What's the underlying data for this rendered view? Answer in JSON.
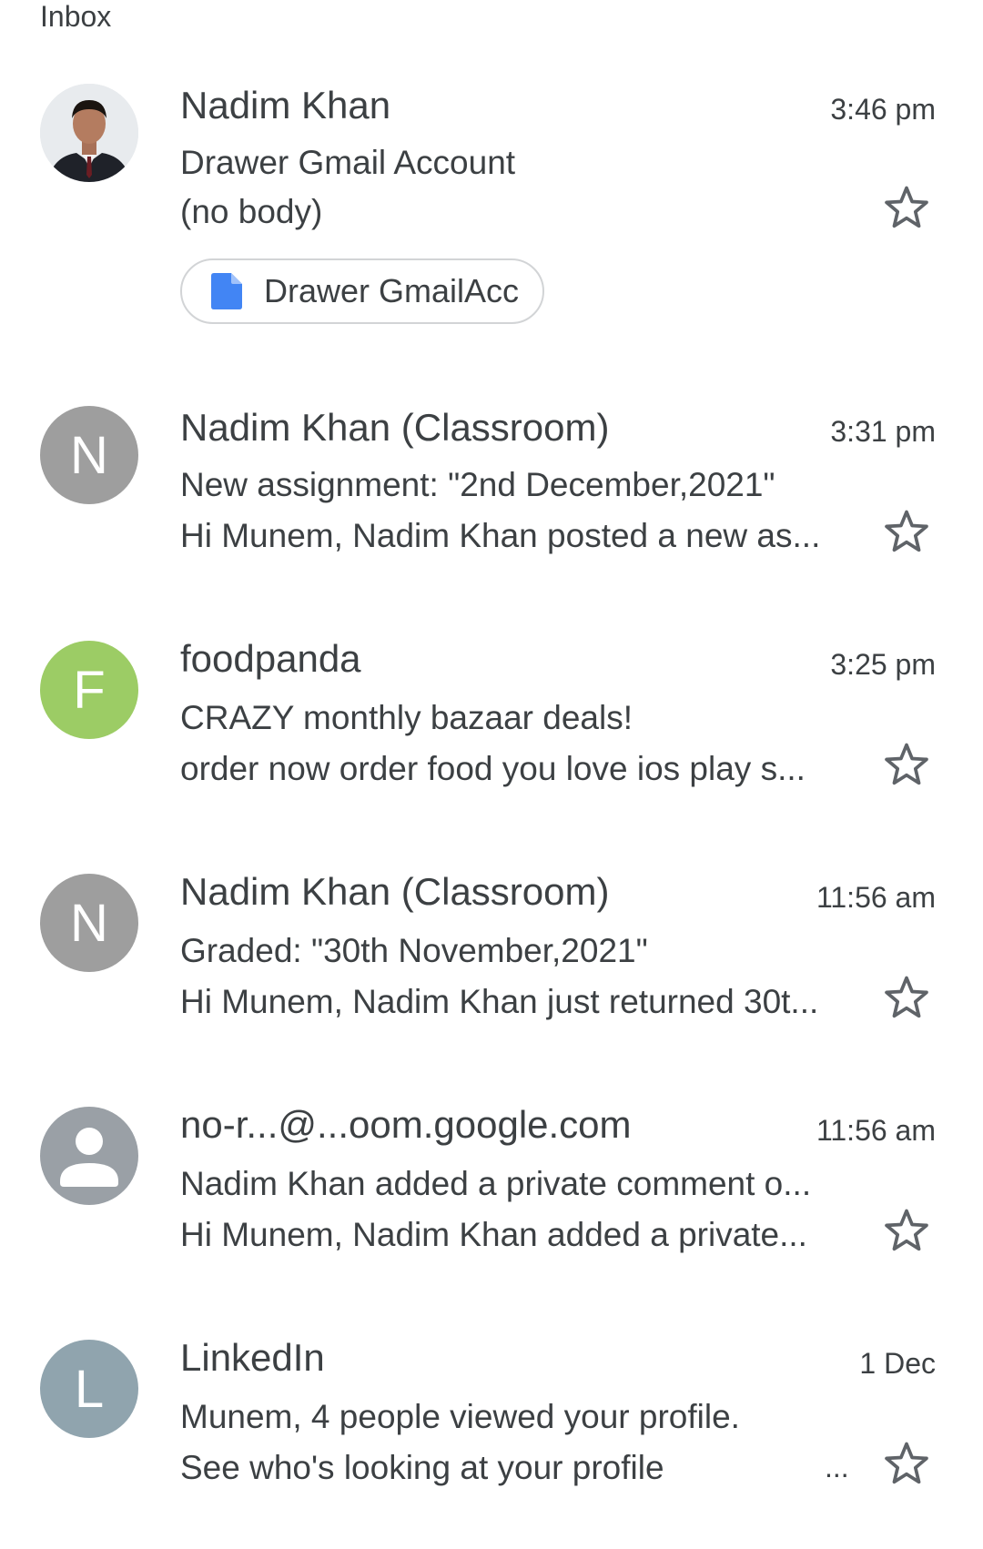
{
  "header": {
    "title": "Inbox"
  },
  "emails": [
    {
      "sender": "Nadim Khan",
      "time": "3:46 pm",
      "subject": "Drawer Gmail Account",
      "snippet": "(no body)",
      "avatar": {
        "type": "photo"
      },
      "attachment": {
        "label": "Drawer GmailAcc",
        "icon": "doc-icon",
        "color": "#4285f4"
      },
      "starred": false
    },
    {
      "sender": "Nadim Khan (Classroom)",
      "time": "3:31 pm",
      "subject": "New assignment: \"2nd December,2021\"",
      "snippet": "Hi Munem, Nadim Khan posted a new as...",
      "avatar": {
        "type": "letter",
        "letter": "N",
        "color": "#9e9e9e"
      },
      "starred": false
    },
    {
      "sender": "foodpanda",
      "time": "3:25 pm",
      "subject": "CRAZY monthly bazaar deals!",
      "snippet": "order now order food you love ios play s...",
      "avatar": {
        "type": "letter",
        "letter": "F",
        "color": "#9ccc65"
      },
      "starred": false
    },
    {
      "sender": "Nadim Khan (Classroom)",
      "time": "11:56 am",
      "subject": "Graded: \"30th  November,2021\"",
      "snippet": "Hi Munem, Nadim Khan just returned 30t...",
      "avatar": {
        "type": "letter",
        "letter": "N",
        "color": "#9e9e9e"
      },
      "starred": false
    },
    {
      "sender": "no-r...@...oom.google.com",
      "time": "11:56 am",
      "subject": "Nadim Khan added a private comment o...",
      "snippet": "Hi Munem, Nadim Khan added a private...",
      "avatar": {
        "type": "icon",
        "icon": "person-icon",
        "color": "#9aa0a6"
      },
      "starred": false
    },
    {
      "sender": "LinkedIn",
      "time": "1 Dec",
      "subject": "Munem, 4 people viewed your profile.",
      "snippet": "See who's looking at your profile",
      "snippet_overflow": "...",
      "avatar": {
        "type": "letter",
        "letter": "L",
        "color": "#90a4ae"
      },
      "starred": false
    }
  ],
  "icons": {
    "star": "star-outline-icon"
  }
}
